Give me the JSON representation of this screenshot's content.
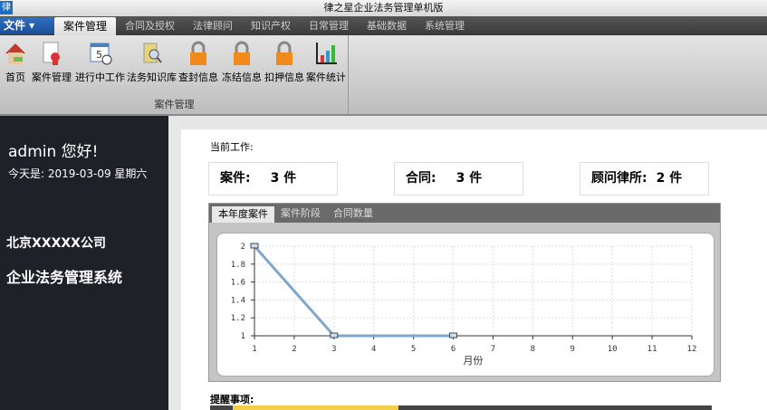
{
  "window": {
    "title": "律之星企业法务管理单机版",
    "icon_text": "律"
  },
  "menu": {
    "file_label": "文件 ▾",
    "tabs": [
      "案件管理",
      "合同及授权",
      "法律顾问",
      "知识产权",
      "日常管理",
      "基础数据",
      "系统管理"
    ]
  },
  "ribbon": {
    "group_label": "案件管理",
    "buttons": [
      {
        "label": "首页",
        "icon": "home-icon"
      },
      {
        "label": "案件管理",
        "icon": "case-document-icon"
      },
      {
        "label": "进行中工作",
        "icon": "calendar-clock-icon"
      },
      {
        "label": "法务知识库",
        "icon": "book-search-icon"
      },
      {
        "label": "查封信息",
        "icon": "lock-seal-icon"
      },
      {
        "label": "冻结信息",
        "icon": "lock-freeze-icon"
      },
      {
        "label": "扣押信息",
        "icon": "lock-detain-icon"
      },
      {
        "label": "案件统计",
        "icon": "bar-chart-icon"
      }
    ]
  },
  "sidebar": {
    "greeting": "admin   您好!",
    "date": "今天是: 2019-03-09  星期六",
    "company": "北京XXXXX公司",
    "system": "企业法务管理系统"
  },
  "main": {
    "current_work": "当前工作:",
    "stats": [
      {
        "label": "案件:",
        "value": "3 件"
      },
      {
        "label": "合同:",
        "value": "3 件"
      },
      {
        "label": "顾问律所:",
        "value": "2 件"
      }
    ],
    "chart_tabs": [
      "本年度案件",
      "案件阶段",
      "合同数量"
    ],
    "reminders": "提醒事项:"
  },
  "chart_data": {
    "type": "line",
    "title": "",
    "xlabel": "月份",
    "ylabel": "",
    "x": [
      1,
      3,
      6
    ],
    "y": [
      2,
      1,
      1
    ],
    "xlim": [
      1,
      12
    ],
    "ylim": [
      1,
      2
    ],
    "xticks": [
      1,
      2,
      3,
      4,
      5,
      6,
      7,
      8,
      9,
      10,
      11,
      12
    ],
    "yticks": [
      "1",
      "1.2",
      "1.4",
      "1.6",
      "1.8",
      "2"
    ],
    "grid": true,
    "color": "#7fa6cf"
  }
}
